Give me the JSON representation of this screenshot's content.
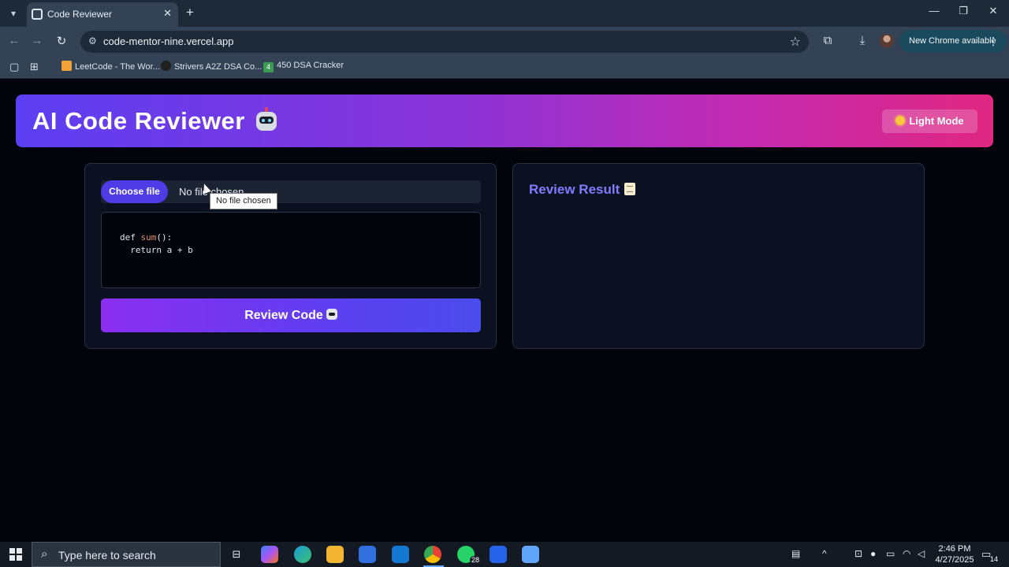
{
  "browser": {
    "tab_title": "Code Reviewer",
    "url": "code-mentor-nine.vercel.app",
    "update_label": "New Chrome available",
    "bookmarks": [
      {
        "label": "LeetCode - The Wor..."
      },
      {
        "label": "Strivers A2Z DSA Co..."
      },
      {
        "label": "450 DSA Cracker",
        "badge": "4"
      }
    ]
  },
  "header": {
    "title": "AI Code Reviewer",
    "theme_toggle_label": "Light Mode"
  },
  "editor": {
    "choose_file_label": "Choose file",
    "file_status": "No file chosen",
    "tooltip": "No file chosen",
    "code": {
      "line1_kw": "def ",
      "line1_fn": "sum",
      "line1_rest": "():",
      "line2": "  return a + b"
    },
    "review_button_label": "Review Code"
  },
  "result": {
    "title": "Review Result"
  },
  "taskbar": {
    "search_placeholder": "Type here to search",
    "whatsapp_badge": "28",
    "time": "2:46 PM",
    "date": "4/27/2025",
    "notification_count": "14"
  },
  "colors": {
    "accent": "#4f3ce6",
    "result_title": "#7f7dff",
    "hero_gradient_start": "#5b3ff2",
    "hero_gradient_end": "#e02781"
  }
}
